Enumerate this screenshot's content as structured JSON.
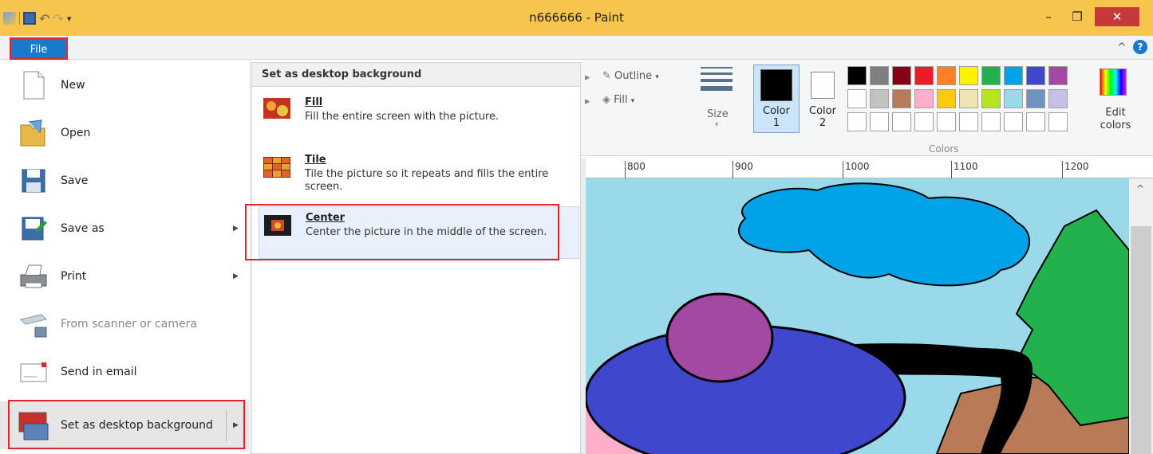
{
  "window": {
    "title": "n666666 - Paint",
    "minimize": "–",
    "maximize": "❐",
    "close": "✕"
  },
  "ribbon": {
    "file_tab": "File",
    "collapse_glyph": "^",
    "help_glyph": "?",
    "outline_label": "Outline",
    "fill_label": "Fill",
    "size_label": "Size",
    "color1_label": "Color",
    "color1_num": "1",
    "color2_label": "Color",
    "color2_num": "2",
    "colors_group_label": "Colors",
    "edit_colors_line1": "Edit",
    "edit_colors_line2": "colors",
    "palette_row1": [
      "#000000",
      "#7f7f7f",
      "#880015",
      "#ed1c24",
      "#ff7f27",
      "#fff200",
      "#22b14c",
      "#00a2e8",
      "#3f48cc",
      "#a349a4"
    ],
    "palette_row2": [
      "#ffffff",
      "#c3c3c3",
      "#b97a57",
      "#ffaec9",
      "#ffc90e",
      "#efe4b0",
      "#b5e61d",
      "#99d9ea",
      "#7092be",
      "#c8bfe7"
    ],
    "palette_row3": [
      "#ffffff",
      "#ffffff",
      "#ffffff",
      "#ffffff",
      "#ffffff",
      "#ffffff",
      "#ffffff",
      "#ffffff",
      "#ffffff",
      "#ffffff"
    ],
    "color1_value": "#000000",
    "color2_value": "#ffffff"
  },
  "ruler": {
    "ticks": [
      "800",
      "900",
      "1000",
      "1100",
      "1200"
    ]
  },
  "file_menu": {
    "items": [
      {
        "label": "New",
        "icon": "new-document-icon",
        "arrow": false
      },
      {
        "label": "Open",
        "icon": "open-folder-icon",
        "arrow": false
      },
      {
        "label": "Save",
        "icon": "floppy-disk-icon",
        "arrow": false
      },
      {
        "label": "Save as",
        "icon": "save-as-icon",
        "arrow": true
      },
      {
        "label": "Print",
        "icon": "printer-icon",
        "arrow": true
      },
      {
        "label": "From scanner or camera",
        "icon": "scanner-icon",
        "arrow": false
      },
      {
        "label": "Send in email",
        "icon": "email-icon",
        "arrow": false
      },
      {
        "label": "Set as desktop background",
        "icon": "desktop-background-icon",
        "arrow": true
      }
    ]
  },
  "submenu": {
    "header": "Set as desktop background",
    "options": [
      {
        "title": "Fill",
        "description": "Fill the entire screen with the picture."
      },
      {
        "title": "Tile",
        "description": "Tile the picture so it repeats and fills the entire screen."
      },
      {
        "title": "Center",
        "description": "Center the picture in the middle of the screen."
      }
    ]
  }
}
